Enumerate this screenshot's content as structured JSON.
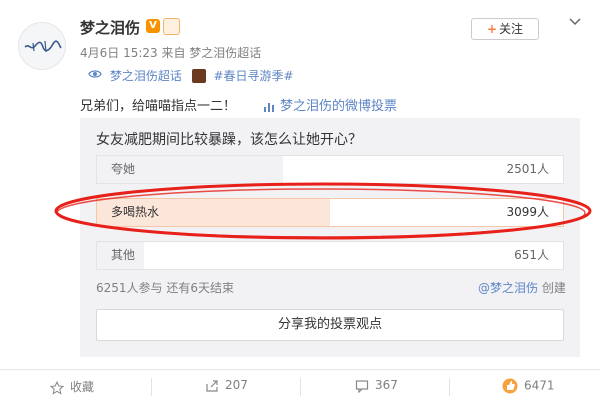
{
  "post": {
    "username": "梦之泪伤",
    "v_badge": "V",
    "meta_text": "4月6日 15:23 来自 梦之泪伤超话",
    "follow_label": "关注",
    "follow_plus": "+",
    "supertalk": "梦之泪伤超话",
    "topic": "#春日寻游季#",
    "content": "兄弟们，给喵喵指点一二！",
    "poll_link": "梦之泪伤的微博投票"
  },
  "poll": {
    "question": "女友减肥期间比较暴躁，该怎么让她开心？",
    "options": [
      {
        "label": "夸她",
        "count": "2501人",
        "share": 0.4
      },
      {
        "label": "多喝热水",
        "count": "3099人",
        "share": 0.5
      },
      {
        "label": "其他",
        "count": "651人",
        "share": 0.1
      }
    ],
    "stats": "6251人参与  还有6天结束",
    "creator_link": "@梦之泪伤",
    "creator_suffix": " 创建",
    "share_button": "分享我的投票观点"
  },
  "actions": {
    "favorite": "收藏",
    "repost": "207",
    "comment": "367",
    "like": "6471"
  },
  "colors": {
    "accent_orange": "#fa7d3c",
    "link_blue": "#5d85c6",
    "topic_orange": "#eb7350",
    "highlight_red": "#e8201a"
  },
  "icons": {
    "menu": "chevron-down-icon",
    "supertalk": "supertalk-icon",
    "poll": "poll-chart-icon",
    "favorite": "star-icon",
    "repost": "share-arrow-icon",
    "comment": "comment-icon",
    "like": "thumbs-up-icon"
  }
}
